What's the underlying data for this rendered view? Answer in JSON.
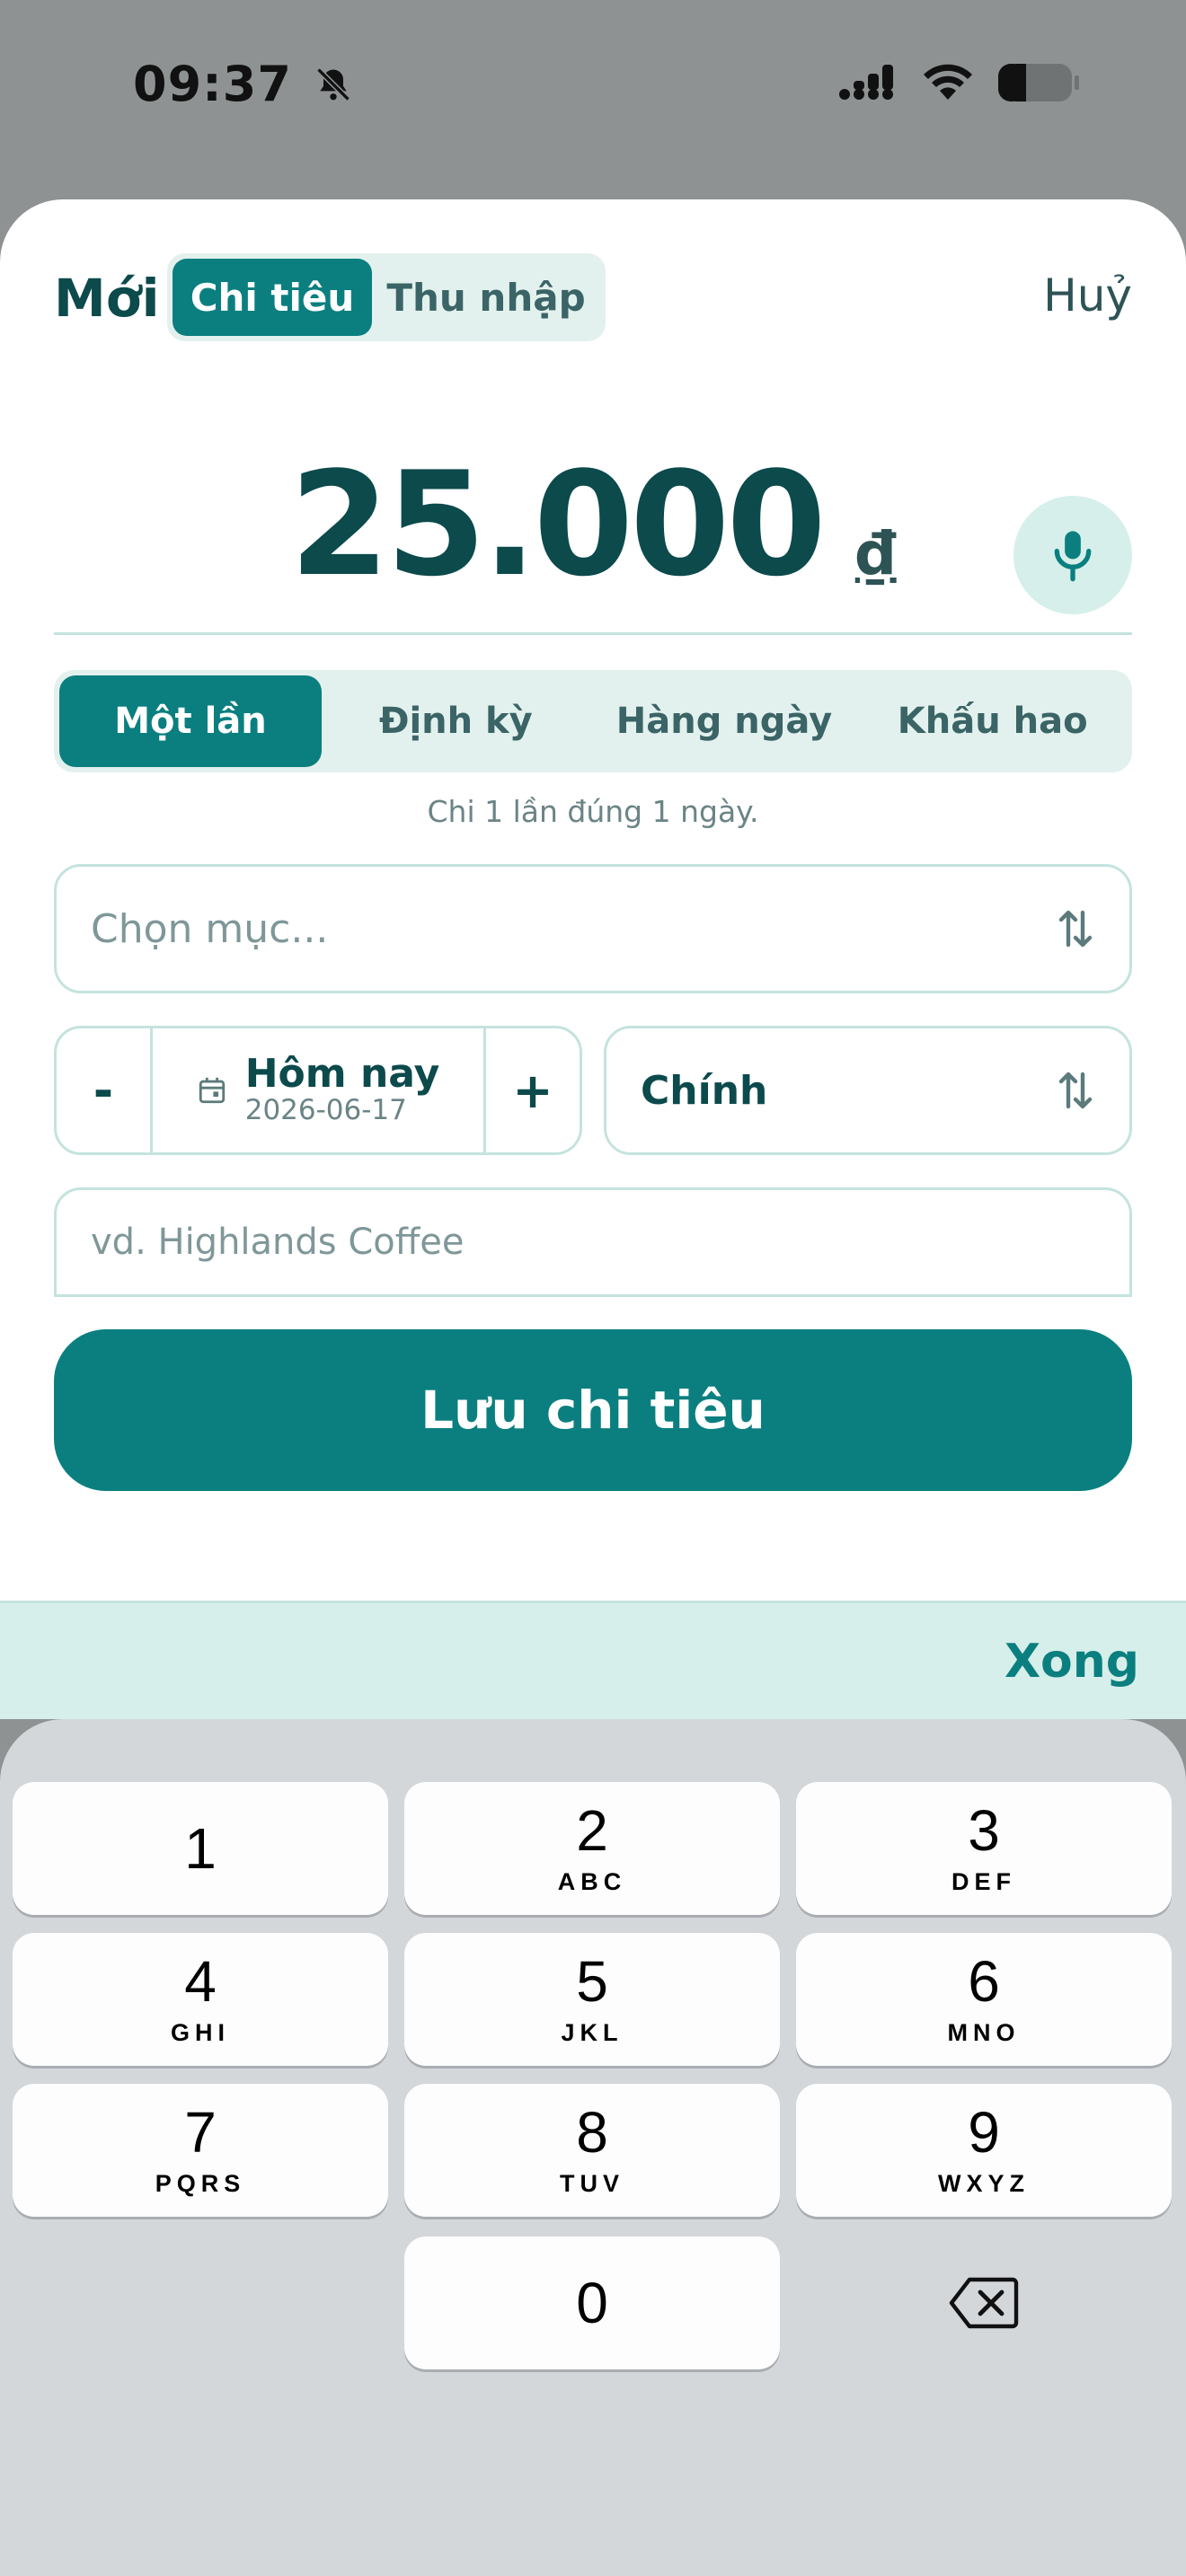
{
  "status_bar": {
    "time": "09:37",
    "silent_icon": "bell-slash-icon",
    "signal_icon": "cellular-signal-icon",
    "wifi_icon": "wifi-icon",
    "battery_icon": "battery-low-icon"
  },
  "header": {
    "title": "Mới",
    "type_tabs": [
      {
        "label": "Chi tiêu",
        "active": true
      },
      {
        "label": "Thu nhập",
        "active": false
      }
    ],
    "cancel_label": "Huỷ"
  },
  "amount": {
    "value": "25.000",
    "currency": "₫",
    "mic_icon": "microphone-icon"
  },
  "frequency": {
    "tabs": [
      {
        "label": "Một lần",
        "active": true
      },
      {
        "label": "Định kỳ",
        "active": false
      },
      {
        "label": "Hàng ngày",
        "active": false
      },
      {
        "label": "Khấu hao",
        "active": false
      }
    ],
    "hint": "Chi 1 lần đúng 1 ngày."
  },
  "category": {
    "placeholder": "Chọn mục...",
    "icon": "sort-arrows-icon"
  },
  "date": {
    "minus": "-",
    "plus": "+",
    "label": "Hôm nay",
    "value": "2026-06-17",
    "icon": "calendar-icon"
  },
  "account": {
    "label": "Chính",
    "icon": "sort-arrows-icon"
  },
  "note": {
    "placeholder": "vd. Highlands Coffee"
  },
  "save_label": "Lưu chi tiêu",
  "accessory": {
    "done_label": "Xong"
  },
  "keypad": {
    "keys": [
      {
        "num": "1",
        "letters": ""
      },
      {
        "num": "2",
        "letters": "ABC"
      },
      {
        "num": "3",
        "letters": "DEF"
      },
      {
        "num": "4",
        "letters": "GHI"
      },
      {
        "num": "5",
        "letters": "JKL"
      },
      {
        "num": "6",
        "letters": "MNO"
      },
      {
        "num": "7",
        "letters": "PQRS"
      },
      {
        "num": "8",
        "letters": "TUV"
      },
      {
        "num": "9",
        "letters": "WXYZ"
      },
      {
        "num": "0",
        "letters": ""
      }
    ],
    "backspace_icon": "backspace-icon"
  },
  "colors": {
    "accent": "#0b7f7f",
    "dark_text": "#0c4a4c",
    "tint": "#e3f1ee"
  }
}
